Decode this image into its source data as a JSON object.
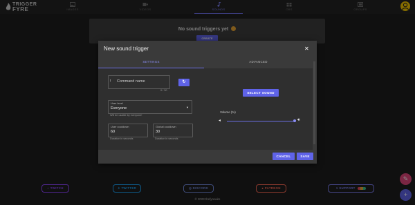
{
  "app": {
    "logo_line1": "TRIGGER",
    "logo_line2": "FYRE"
  },
  "nav": {
    "tabs": [
      {
        "label": "IMAGES"
      },
      {
        "label": "VIDEOS"
      },
      {
        "label": "SOUNDS"
      },
      {
        "label": "OBS"
      },
      {
        "label": "GROUPS"
      }
    ],
    "active_tab": "SOUNDS"
  },
  "page": {
    "empty_text": "No sound triggers yet",
    "create_label": "CREATE"
  },
  "modal": {
    "title": "New sound trigger",
    "tabs": [
      {
        "label": "SETTINGS"
      },
      {
        "label": "ADVANCED"
      }
    ],
    "command": {
      "label": "Command name",
      "required_mark": "!",
      "counter": "0 / 30"
    },
    "user_level": {
      "label": "User level",
      "value": "Everyone",
      "hint": "Will be usable by everyone!"
    },
    "user_cooldown": {
      "label": "User cooldown",
      "value": "60",
      "hint": "Duration in seconds"
    },
    "global_cooldown": {
      "label": "Global cooldown",
      "value": "30",
      "hint": "Duration in seconds"
    },
    "select_sound_label": "SELECT SOUND",
    "volume": {
      "label": "Volume (%)",
      "level_percent": 100
    },
    "cancel_label": "CANCEL",
    "save_label": "SAVE"
  },
  "footer": {
    "links": [
      {
        "label": "TWITCH",
        "color": "#9146ff"
      },
      {
        "label": "TWITTER",
        "color": "#1da1f2"
      },
      {
        "label": "DISCORD",
        "color": "#7289da"
      },
      {
        "label": "PATREON",
        "color": "#f96854"
      },
      {
        "label": "SUPPORT",
        "color": "#7c7ff0"
      }
    ],
    "copyright": "© 2023 thefyrewire"
  },
  "colors": {
    "accent": "#5f63e8",
    "background": "#1e1e1e",
    "modal": "#3a3a3a",
    "avatar": "#f2c500",
    "fab_edit": "#e0457b"
  }
}
